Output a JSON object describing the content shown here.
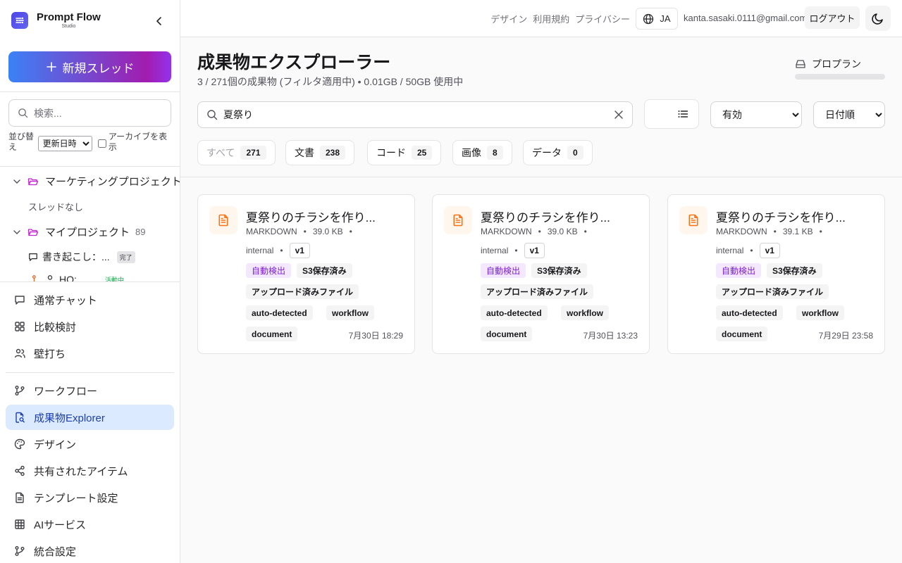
{
  "sidebar": {
    "brand_title": "Prompt Flow",
    "brand_sub": "Studio",
    "new_thread": "新規スレッド",
    "search_placeholder": "検索...",
    "sort_label": "並び替え",
    "sort_value": "更新日時",
    "archive_label": "アーカイブを表示",
    "tree": {
      "project1": "マーケティングプロジェクト",
      "project1_empty": "スレッドなし",
      "project2": "マイプロジェクト",
      "project2_count": "89",
      "thread1": "書き起こし：...",
      "thread1_badge": "完了",
      "thread2": "HO:",
      "thread2_badge": "活動中"
    },
    "nav": [
      {
        "label": "通常チャット",
        "icon": "chat-icon"
      },
      {
        "label": "比較検討",
        "icon": "grid-icon"
      },
      {
        "label": "壁打ち",
        "icon": "users-icon"
      },
      {
        "label": "ワークフロー",
        "icon": "git-branch-icon"
      },
      {
        "label": "成果物Explorer",
        "icon": "file-search-icon"
      },
      {
        "label": "デザイン",
        "icon": "palette-icon"
      },
      {
        "label": "共有されたアイテム",
        "icon": "share-icon"
      },
      {
        "label": "テンプレート設定",
        "icon": "file-text-icon"
      },
      {
        "label": "AIサービス",
        "icon": "table-icon"
      },
      {
        "label": "統合設定",
        "icon": "git-branch-icon"
      }
    ]
  },
  "topbar": {
    "links": [
      "デザイン",
      "利用規約",
      "プライバシー"
    ],
    "lang": "JA",
    "email": "kanta.sasaki.0111@gmail.com",
    "logout": "ログアウト"
  },
  "header": {
    "title": "成果物エクスプローラー",
    "subtitle": "3 / 271個の成果物 (フィルタ適用中) • 0.01GB / 50GB 使用中",
    "plan": "プロプラン",
    "storage_used_fraction": 0.0002
  },
  "filters": {
    "search_value": "夏祭り",
    "status_value": "有効",
    "status_options": [
      "有効"
    ],
    "sort_value": "日付順",
    "sort_options": [
      "日付順"
    ],
    "chips": [
      {
        "label": "すべて",
        "count": "271"
      },
      {
        "label": "文書",
        "count": "238"
      },
      {
        "label": "コード",
        "count": "25"
      },
      {
        "label": "画像",
        "count": "8"
      },
      {
        "label": "データ",
        "count": "0"
      }
    ]
  },
  "cards": [
    {
      "title": "夏祭りのチラシを作り...",
      "format": "MARKDOWN",
      "size": "39.0 KB",
      "source": "internal",
      "version": "v1",
      "tags": [
        "自動検出",
        "S3保存済み",
        "アップロード済みファイル",
        "auto-detected",
        "workflow",
        "document"
      ],
      "date": "7月30日 18:29"
    },
    {
      "title": "夏祭りのチラシを作り...",
      "format": "MARKDOWN",
      "size": "39.0 KB",
      "source": "internal",
      "version": "v1",
      "tags": [
        "自動検出",
        "S3保存済み",
        "アップロード済みファイル",
        "auto-detected",
        "workflow",
        "document"
      ],
      "date": "7月30日 13:23"
    },
    {
      "title": "夏祭りのチラシを作り...",
      "format": "MARKDOWN",
      "size": "39.1 KB",
      "source": "internal",
      "version": "v1",
      "tags": [
        "自動検出",
        "S3保存済み",
        "アップロード済みファイル",
        "auto-detected",
        "workflow",
        "document"
      ],
      "date": "7月29日 23:58"
    }
  ],
  "colors": {
    "accent": "#3b82f6",
    "accent2": "#9333ea",
    "active_nav_bg": "#dbeafe",
    "file_icon": "#f97316",
    "auto_tag": "#7e22ce"
  }
}
